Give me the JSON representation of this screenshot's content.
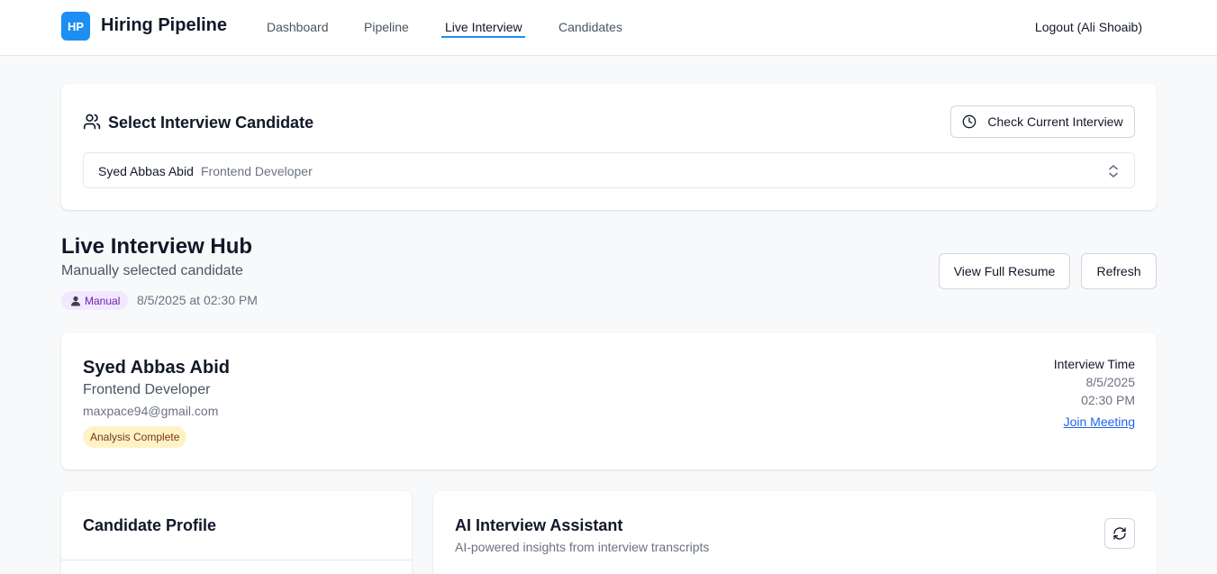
{
  "header": {
    "logo_text": "HP",
    "app_title": "Hiring Pipeline",
    "nav": [
      {
        "label": "Dashboard"
      },
      {
        "label": "Pipeline"
      },
      {
        "label": "Live Interview",
        "active": true
      },
      {
        "label": "Candidates"
      }
    ],
    "logout_label": "Logout (Ali Shoaib)"
  },
  "selector": {
    "title": "Select Interview Candidate",
    "check_button_label": "Check Current Interview",
    "selected_name": "Syed Abbas Abid",
    "selected_role": "Frontend Developer"
  },
  "hub": {
    "title": "Live Interview Hub",
    "subtitle": "Manually selected candidate",
    "badge_label": "Manual",
    "timestamp": "8/5/2025 at 02:30 PM",
    "view_resume_label": "View Full Resume",
    "refresh_label": "Refresh"
  },
  "candidate": {
    "name": "Syed Abbas Abid",
    "role": "Frontend Developer",
    "email": "maxpace94@gmail.com",
    "status": "Analysis Complete",
    "interview_time_label": "Interview Time",
    "interview_date": "8/5/2025",
    "interview_time": "02:30 PM",
    "join_label": "Join Meeting"
  },
  "profile": {
    "title": "Candidate Profile"
  },
  "assistant": {
    "title": "AI Interview Assistant",
    "subtitle": "AI-powered insights from interview transcripts"
  },
  "colors": {
    "accent": "#1d8ef2",
    "manual_badge_bg": "#f3e8ff",
    "analysis_badge_bg": "#fef3c7",
    "link": "#2563eb"
  }
}
